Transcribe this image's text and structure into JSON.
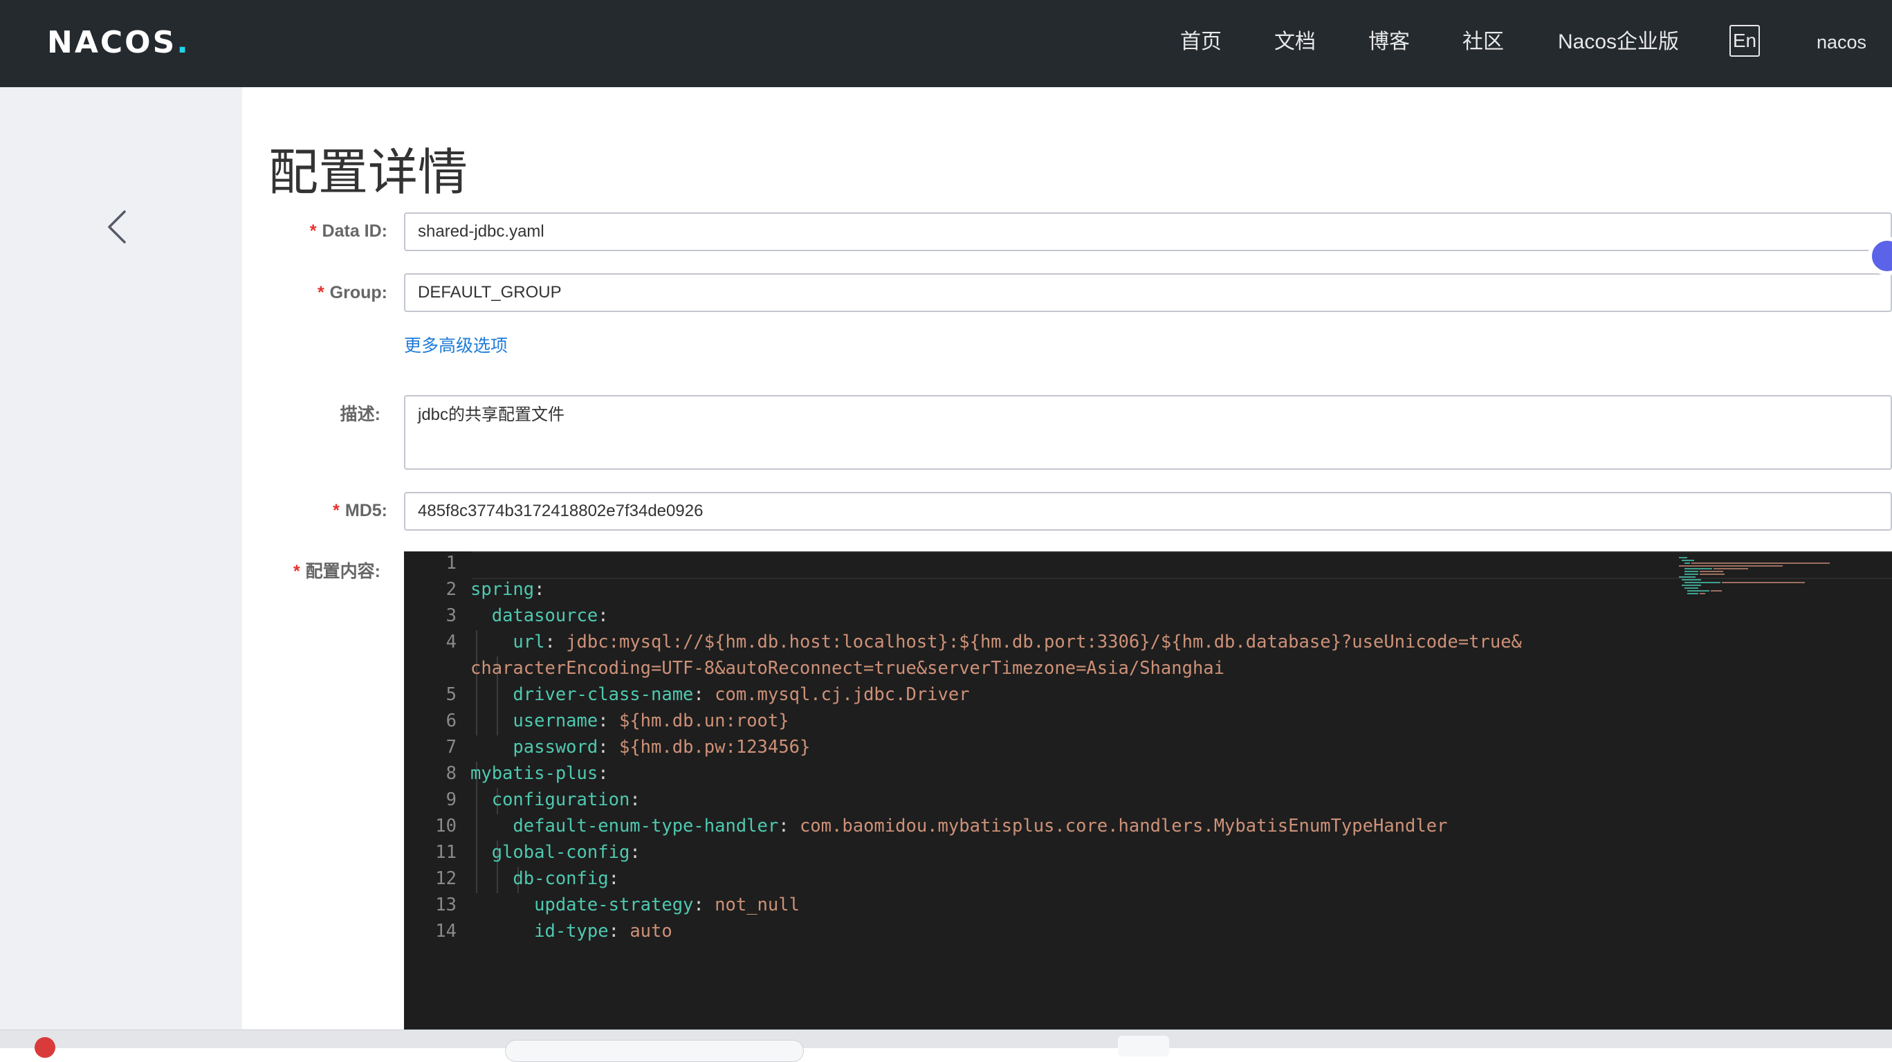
{
  "brand": {
    "logo_text": "NACOS",
    "logo_dot": "."
  },
  "nav": {
    "items": [
      "首页",
      "文档",
      "博客",
      "社区",
      "Nacos企业版"
    ],
    "lang_toggle": "En",
    "user": "nacos"
  },
  "page": {
    "title": "配置详情"
  },
  "form": {
    "data_id": {
      "label": "Data ID:",
      "value": "shared-jdbc.yaml"
    },
    "group": {
      "label": "Group:",
      "value": "DEFAULT_GROUP"
    },
    "advanced_link": "更多高级选项",
    "description": {
      "label": "描述:",
      "value": "jdbc的共享配置文件"
    },
    "md5": {
      "label": "MD5:",
      "value": "485f8c3774b3172418802e7f34de0926"
    },
    "content": {
      "label": "配置内容:"
    },
    "required_mark": "*"
  },
  "editor": {
    "language": "yaml",
    "lines": [
      {
        "n": "1",
        "indent": 0,
        "key": "",
        "value": ""
      },
      {
        "n": "2",
        "indent": 0,
        "key": "spring",
        "value": ""
      },
      {
        "n": "3",
        "indent": 1,
        "key": "datasource",
        "value": ""
      },
      {
        "n": "4",
        "indent": 2,
        "key": "url",
        "value": "jdbc:mysql://${hm.db.host:localhost}:${hm.db.port:3306}/${hm.db.database}?useUnicode=true&",
        "wrap": "characterEncoding=UTF-8&autoReconnect=true&serverTimezone=Asia/Shanghai"
      },
      {
        "n": "5",
        "indent": 2,
        "key": "driver-class-name",
        "value": "com.mysql.cj.jdbc.Driver"
      },
      {
        "n": "6",
        "indent": 2,
        "key": "username",
        "value": "${hm.db.un:root}"
      },
      {
        "n": "7",
        "indent": 2,
        "key": "password",
        "value": "${hm.db.pw:123456}"
      },
      {
        "n": "8",
        "indent": 0,
        "key": "mybatis-plus",
        "value": ""
      },
      {
        "n": "9",
        "indent": 1,
        "key": "configuration",
        "value": ""
      },
      {
        "n": "10",
        "indent": 2,
        "key": "default-enum-type-handler",
        "value": "com.baomidou.mybatisplus.core.handlers.MybatisEnumTypeHandler"
      },
      {
        "n": "11",
        "indent": 1,
        "key": "global-config",
        "value": ""
      },
      {
        "n": "12",
        "indent": 2,
        "key": "db-config",
        "value": ""
      },
      {
        "n": "13",
        "indent": 3,
        "key": "update-strategy",
        "value": "not_null"
      },
      {
        "n": "14",
        "indent": 3,
        "key": "id-type",
        "value": "auto"
      }
    ]
  },
  "colors": {
    "topbar": "#252a2f",
    "sidebar": "#eef0f4",
    "link": "#1f7bd8",
    "required": "#e5322d",
    "editor_bg": "#1e1e1e",
    "yaml_key": "#4ec9b0",
    "yaml_value": "#ce9178"
  },
  "icons": {
    "back": "chevron-left-icon"
  }
}
